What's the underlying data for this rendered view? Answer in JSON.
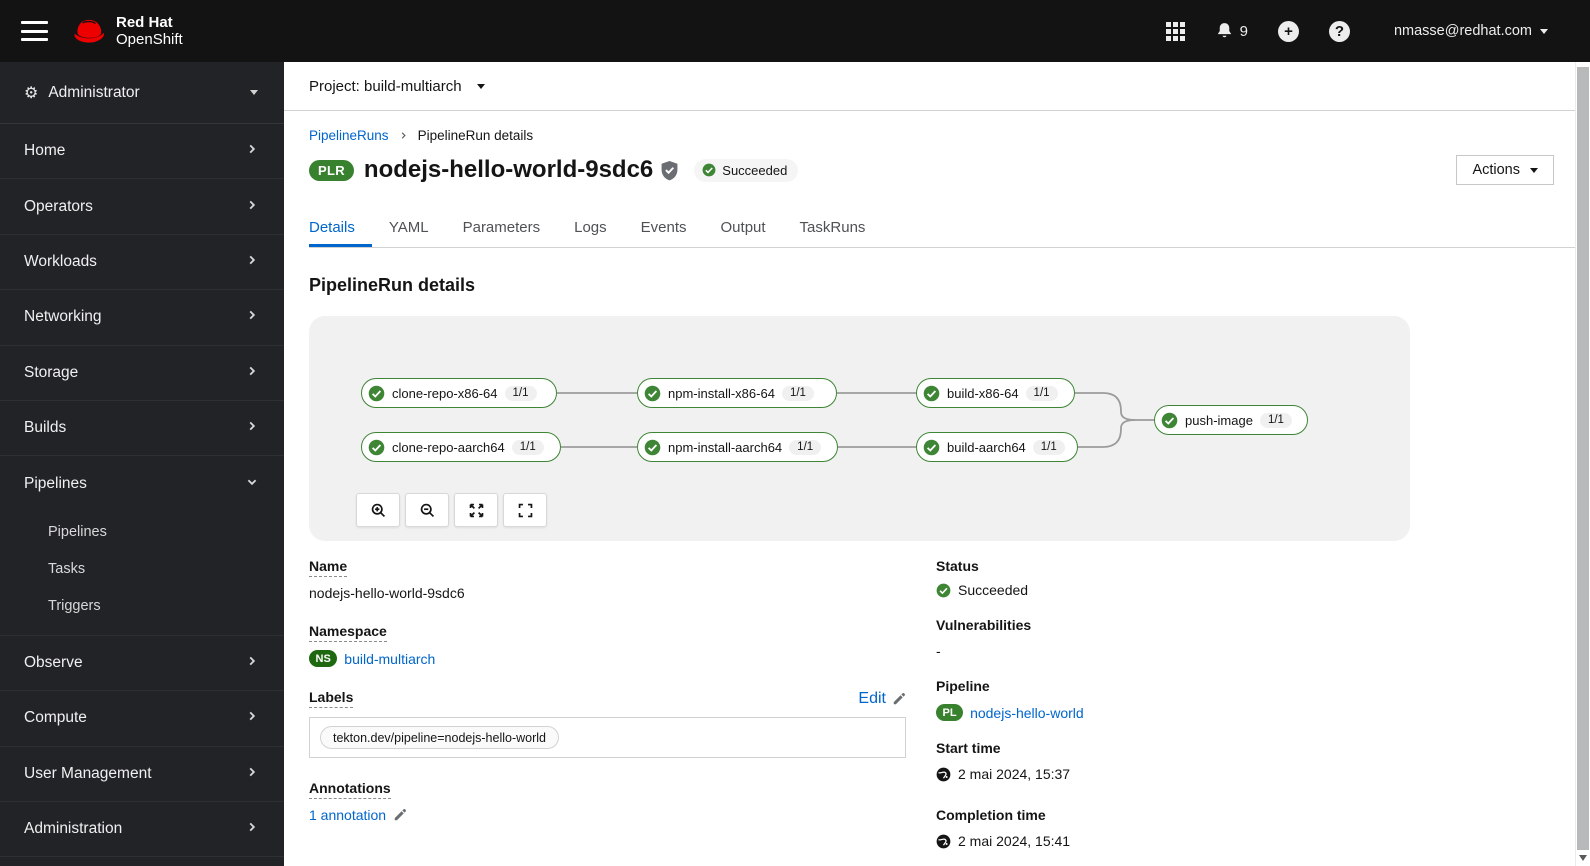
{
  "masthead": {
    "brand_line1": "Red Hat",
    "brand_line2": "OpenShift",
    "notification_count": "9",
    "plus_glyph": "+",
    "question_glyph": "?",
    "user_email": "nmasse@redhat.com"
  },
  "sidebar": {
    "perspective": "Administrator",
    "items": [
      {
        "label": "Home"
      },
      {
        "label": "Operators"
      },
      {
        "label": "Workloads"
      },
      {
        "label": "Networking"
      },
      {
        "label": "Storage"
      },
      {
        "label": "Builds"
      },
      {
        "label": "Pipelines"
      },
      {
        "label": "Observe"
      },
      {
        "label": "Compute"
      },
      {
        "label": "User Management"
      },
      {
        "label": "Administration"
      }
    ],
    "pipelines_subitems": [
      {
        "label": "Pipelines"
      },
      {
        "label": "Tasks"
      },
      {
        "label": "Triggers"
      }
    ]
  },
  "project_bar": {
    "text": "Project: build-multiarch"
  },
  "breadcrumb": {
    "parent": "PipelineRuns",
    "current": "PipelineRun details"
  },
  "page_header": {
    "resource_badge": "PLR",
    "title": "nodejs-hello-world-9sdc6",
    "status": "Succeeded",
    "actions_label": "Actions"
  },
  "tabs": [
    {
      "label": "Details"
    },
    {
      "label": "YAML"
    },
    {
      "label": "Parameters"
    },
    {
      "label": "Logs"
    },
    {
      "label": "Events"
    },
    {
      "label": "Output"
    },
    {
      "label": "TaskRuns"
    }
  ],
  "section_title": "PipelineRun details",
  "pipeline_graph": {
    "nodes": [
      {
        "name": "clone-repo-x86-64",
        "runs": "1/1"
      },
      {
        "name": "npm-install-x86-64",
        "runs": "1/1"
      },
      {
        "name": "build-x86-64",
        "runs": "1/1"
      },
      {
        "name": "clone-repo-aarch64",
        "runs": "1/1"
      },
      {
        "name": "npm-install-aarch64",
        "runs": "1/1"
      },
      {
        "name": "build-aarch64",
        "runs": "1/1"
      },
      {
        "name": "push-image",
        "runs": "1/1"
      }
    ]
  },
  "details": {
    "name_label": "Name",
    "name_value": "nodejs-hello-world-9sdc6",
    "namespace_label": "Namespace",
    "namespace_badge": "NS",
    "namespace_value": "build-multiarch",
    "labels_label": "Labels",
    "edit_label": "Edit",
    "label_chip": "tekton.dev/pipeline=nodejs-hello-world",
    "annotations_label": "Annotations",
    "annotations_value": "1 annotation",
    "status_label": "Status",
    "status_value": "Succeeded",
    "vulnerabilities_label": "Vulnerabilities",
    "vulnerabilities_value": "-",
    "pipeline_label": "Pipeline",
    "pipeline_badge": "PL",
    "pipeline_value": "nodejs-hello-world",
    "start_time_label": "Start time",
    "start_time_value": "2 mai 2024, 15:37",
    "completion_time_label": "Completion time",
    "completion_time_value": "2 mai 2024, 15:41"
  },
  "colors": {
    "success_green": "#3e8635",
    "badge_green": "#38812f",
    "link_blue": "#0066cc",
    "masthead_black": "#131313",
    "sidebar_dark": "#212327"
  }
}
